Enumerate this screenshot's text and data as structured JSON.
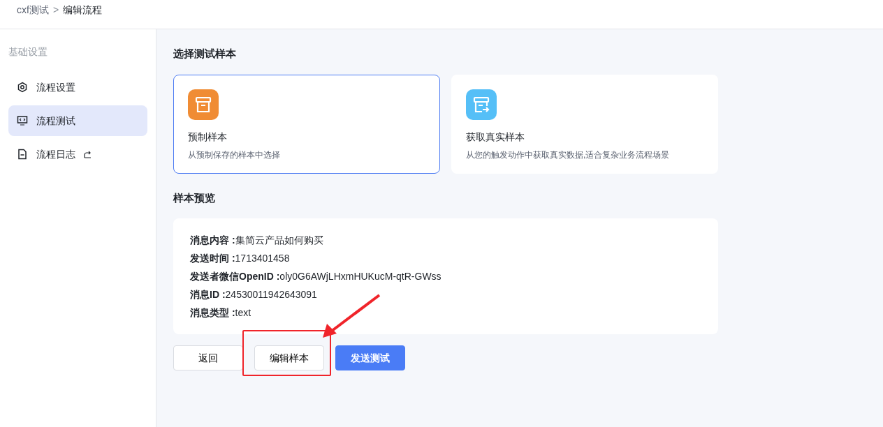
{
  "breadcrumb": [
    {
      "label": "cxf测试",
      "current": false
    },
    {
      "label": "编辑流程",
      "current": true
    }
  ],
  "breadcrumb_separator": ">",
  "sidebar": {
    "section_title": "基础设置",
    "items": [
      {
        "label": "流程设置",
        "kind": "gear",
        "selected": false,
        "external": false
      },
      {
        "label": "流程测试",
        "kind": "monitor",
        "selected": true,
        "external": false
      },
      {
        "label": "流程日志",
        "kind": "doc",
        "selected": false,
        "external": true
      }
    ]
  },
  "sample_section": {
    "title": "选择测试样本",
    "options": [
      {
        "title": "预制样本",
        "description": "从预制保存的样本中选择",
        "kind": "box",
        "color": "#f08c34",
        "selected": true
      },
      {
        "title": "获取真实样本",
        "description": "从您的触发动作中获取真实数据,适合复杂业务流程场景",
        "kind": "box-arrow",
        "color": "#55bff7",
        "selected": false
      }
    ]
  },
  "preview": {
    "title": "样本预览",
    "fields": [
      {
        "label": "消息内容 :",
        "value": "集简云产品如何购买"
      },
      {
        "label": "发送时间 :",
        "value": "1713401458"
      },
      {
        "label": "发送者微信OpenID :",
        "value": "oly0G6AWjLHxmHUKucM-qtR-GWss"
      },
      {
        "label": "消息ID :",
        "value": "24530011942643091"
      },
      {
        "label": "消息类型 :",
        "value": "text"
      }
    ]
  },
  "buttons": [
    {
      "label": "返回",
      "kind": "secondary"
    },
    {
      "label": "编辑样本",
      "kind": "secondary"
    },
    {
      "label": "发送测试",
      "kind": "primary"
    }
  ]
}
